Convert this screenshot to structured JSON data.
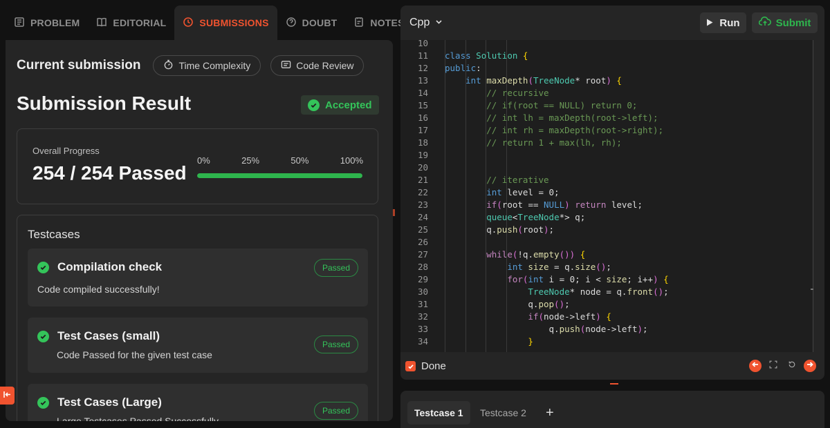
{
  "tabs": [
    {
      "label": "PROBLEM",
      "icon": "problem-icon"
    },
    {
      "label": "EDITORIAL",
      "icon": "book-icon"
    },
    {
      "label": "SUBMISSIONS",
      "icon": "clock-icon"
    },
    {
      "label": "DOUBT",
      "icon": "doubt-icon"
    },
    {
      "label": "NOTES",
      "icon": "notes-icon"
    }
  ],
  "submission": {
    "current_label": "Current submission",
    "time_complexity_label": "Time Complexity",
    "code_review_label": "Code Review",
    "result_title": "Submission Result",
    "status": "Accepted",
    "progress_label": "Overall Progress",
    "progress_value": "254 / 254 Passed",
    "progress_fraction": 1.0,
    "progress_ticks": [
      "0%",
      "25%",
      "50%",
      "100%"
    ],
    "testcases_title": "Testcases",
    "testcases": [
      {
        "title": "Compilation check",
        "desc": "Code compiled successfully!",
        "badge": "Passed"
      },
      {
        "title": "Test Cases (small)",
        "desc": "Code Passed for the given test case",
        "badge": "Passed"
      },
      {
        "title": "Test Cases (Large)",
        "desc": "Large Testcases Passed Successfully",
        "badge": "Passed"
      }
    ]
  },
  "editor": {
    "language": "Cpp",
    "run_label": "Run",
    "submit_label": "Submit",
    "done_label": "Done",
    "lines": [
      {
        "n": "10",
        "text": ""
      },
      {
        "n": "11",
        "text": "class Solution {"
      },
      {
        "n": "12",
        "text": "public:"
      },
      {
        "n": "13",
        "text": "    int maxDepth(TreeNode* root) {"
      },
      {
        "n": "14",
        "text": "        // recursive"
      },
      {
        "n": "15",
        "text": "        // if(root == NULL) return 0;"
      },
      {
        "n": "16",
        "text": "        // int lh = maxDepth(root->left);"
      },
      {
        "n": "17",
        "text": "        // int rh = maxDepth(root->right);"
      },
      {
        "n": "18",
        "text": "        // return 1 + max(lh, rh);"
      },
      {
        "n": "19",
        "text": ""
      },
      {
        "n": "20",
        "text": ""
      },
      {
        "n": "21",
        "text": "        // iterative"
      },
      {
        "n": "22",
        "text": "        int level = 0;"
      },
      {
        "n": "23",
        "text": "        if(root == NULL) return level;"
      },
      {
        "n": "24",
        "text": "        queue<TreeNode*> q;"
      },
      {
        "n": "25",
        "text": "        q.push(root);"
      },
      {
        "n": "26",
        "text": ""
      },
      {
        "n": "27",
        "text": "        while(!q.empty()) {"
      },
      {
        "n": "28",
        "text": "            int size = q.size();"
      },
      {
        "n": "29",
        "text": "            for(int i = 0; i < size; i++) {"
      },
      {
        "n": "30",
        "text": "                TreeNode* node = q.front();"
      },
      {
        "n": "31",
        "text": "                q.pop();"
      },
      {
        "n": "32",
        "text": "                if(node->left) {"
      },
      {
        "n": "33",
        "text": "                    q.push(node->left);"
      },
      {
        "n": "34",
        "text": "                }"
      }
    ]
  },
  "bottom_tabs": [
    "Testcase 1",
    "Testcase 2"
  ],
  "colors": {
    "accent": "#f0532f",
    "success": "#34c45a",
    "panel": "#252525",
    "background": "#121212"
  }
}
